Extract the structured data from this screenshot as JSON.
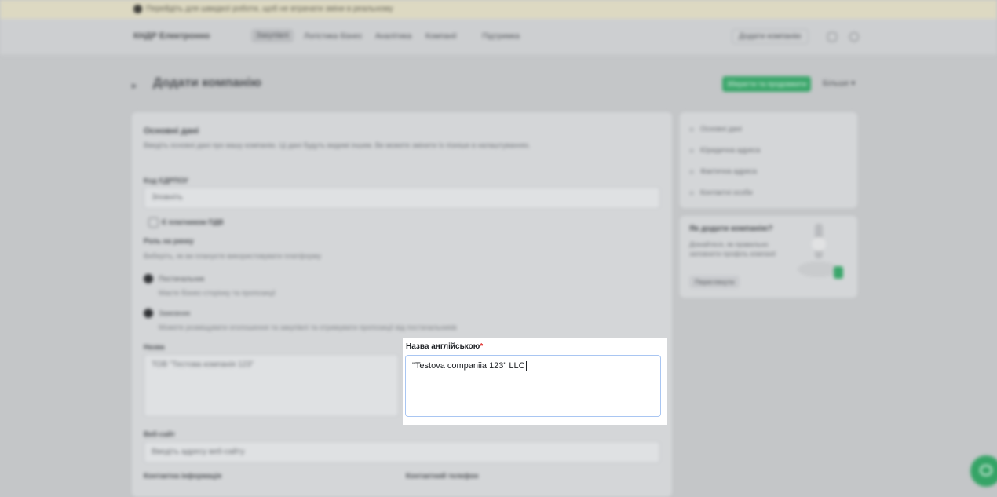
{
  "banner": {
    "text": "Перейдіть для швидкої роботи, щоб не втрачати зміни в реальному"
  },
  "header": {
    "logo": "КНДР Електронно",
    "nav": [
      "Закупівлі",
      "Логістика бізнес",
      "Аналітика",
      "Компанії",
      "Підтримка"
    ],
    "active_nav_index": 0,
    "add_company_button": "Додати компанію"
  },
  "page": {
    "title": "Додати компанію",
    "save_button": "Зберегти та продовжити",
    "more_button": "Більше"
  },
  "form": {
    "section_title": "Основні дані",
    "section_desc": "Введіть основні дані про вашу компанію. Ці дані будуть видимі іншим. Ви можете змінити їх пізніше в налаштуваннях.",
    "edrpou_label": "Код ЄДРПОУ",
    "edrpou_value": "Зповніть",
    "vat_checkbox": "Є платником ПДВ",
    "role_label": "Роль на ринку",
    "role_desc": "Виберіть, як ви плануєте використовувати платформу",
    "role_option_1": "Постачальник",
    "role_option_1_desc": "Маєте бізнес-сторінку та пропозиції",
    "role_option_2": "Замовник",
    "role_option_2_desc": "Можете розміщувати оголошення та закупівлі та отримувати пропозиції від постачальників",
    "name_label": "Назва",
    "name_value": "ТОВ \"Тестова компанія 123\"",
    "web_label": "Веб-сайт",
    "web_placeholder": "Введіть адресу веб-сайту",
    "contact_label": "Контактна інформація",
    "phone_label": "Контактний телефон"
  },
  "sidebar": {
    "items": [
      "Основні дані",
      "Юридична адреса",
      "Фактична адреса",
      "Контактні особи"
    ]
  },
  "promo": {
    "title": "Як додати компанію?",
    "text": "Дізнайтеся, як правильно заповнити профіль компанії",
    "button": "Переглянути"
  },
  "focused_field": {
    "label": "Назва англійською",
    "required_mark": "*",
    "value": "\"Testova companiia 123\" LLC"
  },
  "colors": {
    "primary": "#3aa66a",
    "focus_border": "#a9c6f2",
    "required": "#e0312f"
  }
}
